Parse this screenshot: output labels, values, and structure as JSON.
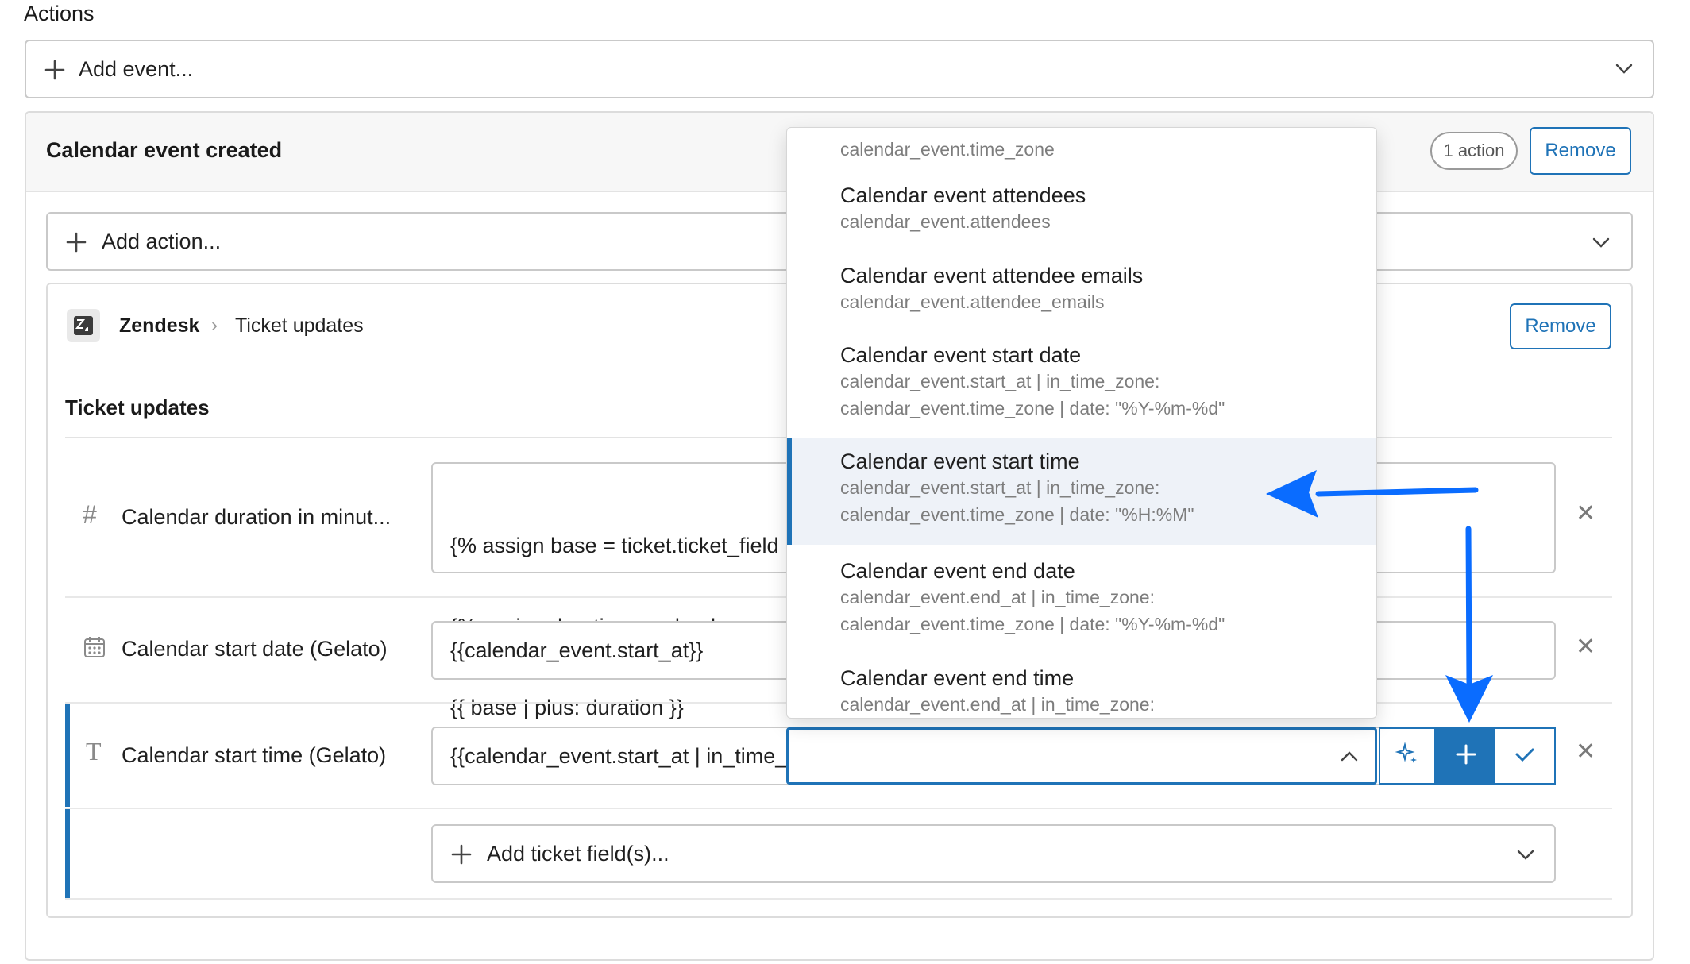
{
  "actions": {
    "heading": "Actions",
    "add_event_placeholder": "Add event..."
  },
  "event_card": {
    "title": "Calendar event created",
    "action_count": "1 action",
    "remove_label": "Remove",
    "add_action_placeholder": "Add action..."
  },
  "action_card": {
    "app_name": "Zendesk",
    "breadcrumb_separator": "›",
    "breadcrumb_item": "Ticket updates",
    "remove_label": "Remove",
    "section_title": "Ticket updates",
    "fields": [
      {
        "label": "Calendar duration in minut...",
        "icon": "hash-icon",
        "code_lines": [
          "{% assign base = ticket.ticket_field",
          "{% assign duration = calendar_even",
          "{{ base | plus: duration }}"
        ]
      },
      {
        "label": "Calendar start date (Gelato)",
        "icon": "calendar-icon",
        "value": "{{calendar_event.start_at}}"
      },
      {
        "label": "Calendar start time (Gelato)",
        "icon": "text-icon",
        "value": "{{calendar_event.start_at | in_time_"
      }
    ],
    "add_ticket_field_placeholder": "Add ticket field(s)..."
  },
  "dropdown": {
    "partial_top": "calendar_event.time_zone",
    "items": [
      {
        "title": "Calendar event attendees",
        "sub": [
          "calendar_event.attendees"
        ]
      },
      {
        "title": "Calendar event attendee emails",
        "sub": [
          "calendar_event.attendee_emails"
        ]
      },
      {
        "title": "Calendar event start date",
        "sub": [
          "calendar_event.start_at | in_time_zone:",
          "calendar_event.time_zone | date: \"%Y-%m-%d\""
        ]
      },
      {
        "title": "Calendar event start time",
        "sub": [
          "calendar_event.start_at | in_time_zone:",
          "calendar_event.time_zone | date: \"%H:%M\""
        ]
      },
      {
        "title": "Calendar event end date",
        "sub": [
          "calendar_event.end_at | in_time_zone:",
          "calendar_event.time_zone | date: \"%Y-%m-%d\""
        ]
      },
      {
        "title": "Calendar event end time",
        "sub": [
          "calendar_event.end_at | in_time_zone:"
        ]
      }
    ],
    "active_index": 3
  },
  "colors": {
    "accent": "#1f73b7",
    "annotation_arrow": "#0a6cff",
    "border": "#c9c9c9"
  }
}
